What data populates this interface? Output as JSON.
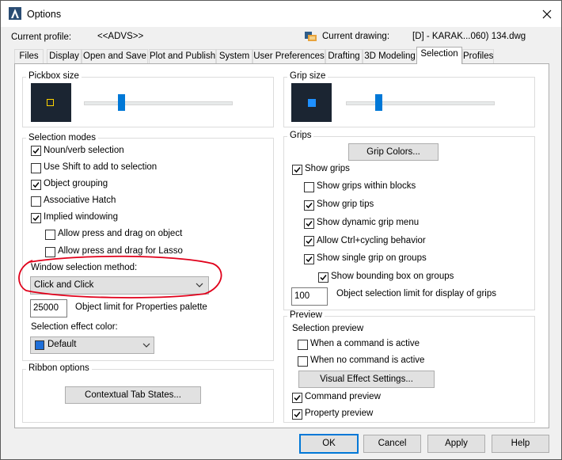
{
  "window": {
    "title": "Options"
  },
  "header": {
    "current_profile_label": "Current profile:",
    "current_profile_value": "<<ADVS>>",
    "current_drawing_label": "Current drawing:",
    "current_drawing_value": "[D] - KARAK...060) 134.dwg"
  },
  "tabs": [
    {
      "label": "Files"
    },
    {
      "label": "Display"
    },
    {
      "label": "Open and Save"
    },
    {
      "label": "Plot and Publish"
    },
    {
      "label": "System"
    },
    {
      "label": "User Preferences"
    },
    {
      "label": "Drafting"
    },
    {
      "label": "3D Modeling"
    },
    {
      "label": "Selection",
      "active": true
    },
    {
      "label": "Profiles"
    }
  ],
  "pickbox": {
    "title": "Pickbox size",
    "slider_value": 0.25
  },
  "gripsize": {
    "title": "Grip size",
    "slider_value": 0.22
  },
  "selection_modes": {
    "title": "Selection modes",
    "options": [
      {
        "label": "Noun/verb selection",
        "checked": true
      },
      {
        "label": "Use Shift to add to selection",
        "checked": false
      },
      {
        "label": "Object grouping",
        "checked": true
      },
      {
        "label": "Associative Hatch",
        "checked": false
      },
      {
        "label": "Implied windowing",
        "checked": true
      },
      {
        "label": "Allow press and drag on object",
        "checked": false
      },
      {
        "label": "Allow press and drag for Lasso",
        "checked": false
      }
    ],
    "window_method_label": "Window selection method:",
    "window_method_value": "Click and Click",
    "object_limit_value": "25000",
    "object_limit_label": "Object limit for Properties palette",
    "effect_color_label": "Selection effect color:",
    "effect_color_value": "Default",
    "effect_color_swatch": "#1e6fd9"
  },
  "ribbon": {
    "title": "Ribbon options",
    "button": "Contextual Tab States..."
  },
  "grips": {
    "title": "Grips",
    "color_button": "Grip Colors...",
    "options": [
      {
        "label": "Show grips",
        "checked": true
      },
      {
        "label": "Show grips within blocks",
        "checked": false
      },
      {
        "label": "Show grip tips",
        "checked": true
      },
      {
        "label": "Show dynamic grip menu",
        "checked": true
      },
      {
        "label": "Allow Ctrl+cycling behavior",
        "checked": true
      },
      {
        "label": "Show single grip on groups",
        "checked": true
      },
      {
        "label": "Show bounding box on groups",
        "checked": true
      }
    ],
    "limit_value": "100",
    "limit_label": "Object selection limit for display of grips"
  },
  "preview": {
    "title": "Preview",
    "subtitle": "Selection preview",
    "options": [
      {
        "label": "When a command is active",
        "checked": false
      },
      {
        "label": "When no command is active",
        "checked": false
      }
    ],
    "visual_button": "Visual Effect Settings...",
    "command_preview": {
      "label": "Command preview",
      "checked": true
    },
    "property_preview": {
      "label": "Property preview",
      "checked": true
    }
  },
  "buttons": {
    "ok": "OK",
    "cancel": "Cancel",
    "apply": "Apply",
    "help": "Help"
  },
  "colors": {
    "accent": "#0078d7",
    "annotation": "#e0001a",
    "swatch_bg": "#1b2532",
    "pickbox_square": "#ffd400",
    "grip_square": "#1e90ff"
  }
}
